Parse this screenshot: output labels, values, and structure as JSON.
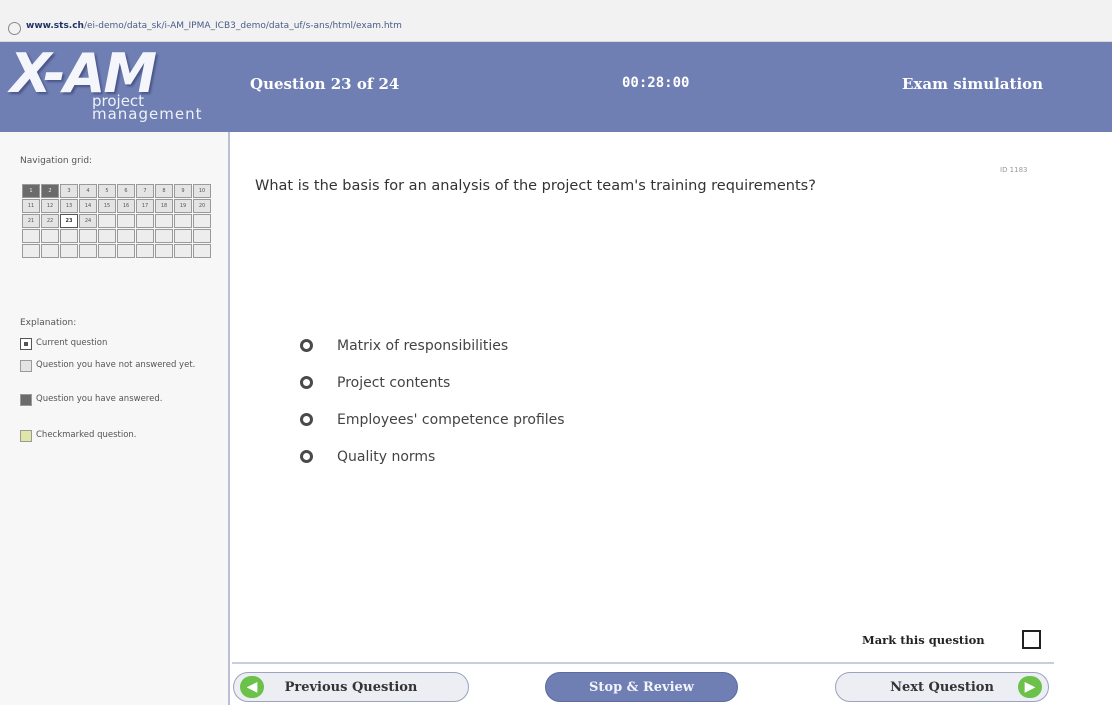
{
  "browser": {
    "host": "www.sts.ch",
    "path": "/ei-demo/data_sk/i-AM_IPMA_ICB3_demo/data_uf/s-ans/html/exam.htm"
  },
  "header": {
    "logo_main": "X-AM",
    "logo_sub1": "project",
    "logo_sub2": "management",
    "question_counter": "Question 23 of 24",
    "timer": "00:28:00",
    "mode": "Exam simulation"
  },
  "sidebar": {
    "nav_label": "Navigation grid:",
    "grid": [
      {
        "label": "1",
        "state": "answered"
      },
      {
        "label": "2",
        "state": "answered"
      },
      {
        "label": "3",
        "state": "unanswered"
      },
      {
        "label": "4",
        "state": "unanswered"
      },
      {
        "label": "5",
        "state": "unanswered"
      },
      {
        "label": "6",
        "state": "unanswered"
      },
      {
        "label": "7",
        "state": "unanswered"
      },
      {
        "label": "8",
        "state": "unanswered"
      },
      {
        "label": "9",
        "state": "unanswered"
      },
      {
        "label": "10",
        "state": "unanswered"
      },
      {
        "label": "11",
        "state": "unanswered"
      },
      {
        "label": "12",
        "state": "unanswered"
      },
      {
        "label": "13",
        "state": "unanswered"
      },
      {
        "label": "14",
        "state": "unanswered"
      },
      {
        "label": "15",
        "state": "unanswered"
      },
      {
        "label": "16",
        "state": "unanswered"
      },
      {
        "label": "17",
        "state": "unanswered"
      },
      {
        "label": "18",
        "state": "unanswered"
      },
      {
        "label": "19",
        "state": "unanswered"
      },
      {
        "label": "20",
        "state": "unanswered"
      },
      {
        "label": "21",
        "state": "unanswered"
      },
      {
        "label": "22",
        "state": "unanswered"
      },
      {
        "label": "23",
        "state": "current"
      },
      {
        "label": "24",
        "state": "unanswered"
      },
      {
        "label": "",
        "state": "empty"
      },
      {
        "label": "",
        "state": "empty"
      },
      {
        "label": "",
        "state": "empty"
      },
      {
        "label": "",
        "state": "empty"
      },
      {
        "label": "",
        "state": "empty"
      },
      {
        "label": "",
        "state": "empty"
      },
      {
        "label": "",
        "state": "empty"
      },
      {
        "label": "",
        "state": "empty"
      },
      {
        "label": "",
        "state": "empty"
      },
      {
        "label": "",
        "state": "empty"
      },
      {
        "label": "",
        "state": "empty"
      },
      {
        "label": "",
        "state": "empty"
      },
      {
        "label": "",
        "state": "empty"
      },
      {
        "label": "",
        "state": "empty"
      },
      {
        "label": "",
        "state": "empty"
      },
      {
        "label": "",
        "state": "empty"
      },
      {
        "label": "",
        "state": "empty"
      },
      {
        "label": "",
        "state": "empty"
      },
      {
        "label": "",
        "state": "empty"
      },
      {
        "label": "",
        "state": "empty"
      },
      {
        "label": "",
        "state": "empty"
      },
      {
        "label": "",
        "state": "empty"
      },
      {
        "label": "",
        "state": "empty"
      },
      {
        "label": "",
        "state": "empty"
      },
      {
        "label": "",
        "state": "empty"
      },
      {
        "label": "",
        "state": "empty"
      }
    ],
    "explanation_label": "Explanation:",
    "legend": [
      {
        "kind": "current",
        "text": "Current question"
      },
      {
        "kind": "unanswered",
        "text": "Question you have not answered yet."
      },
      {
        "kind": "answered",
        "text": "Question you have answered."
      },
      {
        "kind": "marked",
        "text": "Checkmarked question."
      }
    ]
  },
  "question": {
    "id": "ID 1183",
    "text": "What is the basis for an analysis of the project team's training requirements?",
    "answers": [
      "Matrix of responsibilities",
      "Project contents",
      "Employees' competence profiles",
      "Quality norms"
    ],
    "mark_label": "Mark this question"
  },
  "footer": {
    "prev_label": "Previous Question",
    "stop_label": "Stop & Review",
    "next_label": "Next Question"
  },
  "colors": {
    "header_bg": "#6f7fb3",
    "answered_cell": "#6b6b6b",
    "nav_arrow": "#6cc14a"
  }
}
